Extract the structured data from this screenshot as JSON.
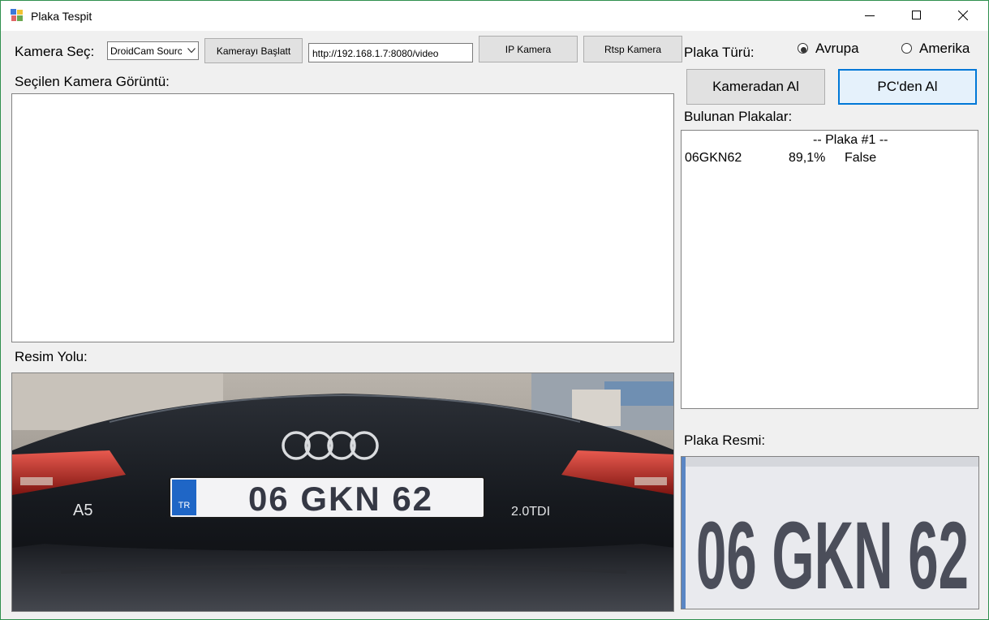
{
  "window": {
    "title": "Plaka Tespit"
  },
  "camera": {
    "select_label": "Kamera Seç:",
    "selected_source": "DroidCam Source",
    "start_button": "Kamerayı Başlatt",
    "url_value": "http://192.168.1.7:8080/video",
    "ip_button": "IP Kamera",
    "rtsp_button": "Rtsp Kamera",
    "view_label": "Seçilen Kamera Görüntü:"
  },
  "plate_type": {
    "label": "Plaka Türü:",
    "options": [
      {
        "label": "Avrupa",
        "selected": true
      },
      {
        "label": "Amerika",
        "selected": false
      }
    ]
  },
  "actions": {
    "from_camera": "Kameradan Al",
    "from_pc": "PC'den Al"
  },
  "results": {
    "label": "Bulunan Plakalar:",
    "header": "-- Plaka #1 --",
    "entries": [
      {
        "plate": "06GKN62",
        "confidence": "89,1%",
        "match": "False"
      }
    ]
  },
  "image": {
    "path_label": "Resim Yolu:",
    "plate_image_label": "Plaka Resmi:",
    "plate_text": "06 GKN 62",
    "plate_country": "TR",
    "car_model": "A5",
    "car_badge": "2.0TDI"
  }
}
